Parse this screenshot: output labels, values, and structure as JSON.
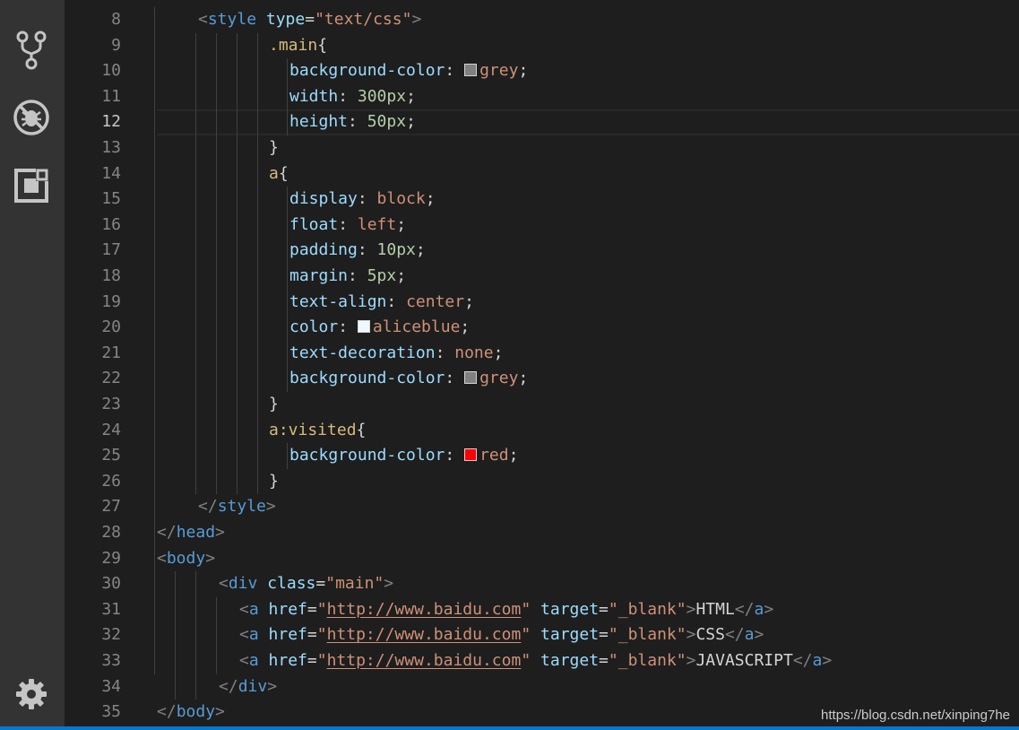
{
  "activity_bar": {
    "icons": [
      "source-control-icon",
      "debug-icon",
      "extensions-icon",
      "settings-gear-icon"
    ]
  },
  "editor": {
    "active_line": "12",
    "line_numbers": [
      "8",
      "9",
      "10",
      "11",
      "12",
      "13",
      "14",
      "15",
      "16",
      "17",
      "18",
      "19",
      "20",
      "21",
      "22",
      "23",
      "24",
      "25",
      "26",
      "27",
      "28",
      "29",
      "30",
      "31",
      "32",
      "33",
      "34",
      "35"
    ],
    "lines": [
      {
        "n": "8",
        "parts": [
          [
            "punc",
            "<"
          ],
          [
            "tag",
            "style"
          ],
          [
            "txt",
            " "
          ],
          [
            "attr",
            "type"
          ],
          [
            "txt",
            "="
          ],
          [
            "str",
            "\"text/css\""
          ],
          [
            "punc",
            ">"
          ]
        ]
      },
      {
        "n": "9",
        "parts": [
          [
            "sel",
            ".main"
          ],
          [
            "txt",
            "{"
          ]
        ]
      },
      {
        "n": "10",
        "parts": [
          [
            "prop",
            "background-color"
          ],
          [
            "txt",
            ": "
          ],
          [
            "swatch",
            "#808080"
          ],
          [
            "val",
            "grey"
          ],
          [
            "txt",
            ";"
          ]
        ]
      },
      {
        "n": "11",
        "parts": [
          [
            "prop",
            "width"
          ],
          [
            "txt",
            ": "
          ],
          [
            "num",
            "300px"
          ],
          [
            "txt",
            ";"
          ]
        ]
      },
      {
        "n": "12",
        "parts": [
          [
            "prop",
            "height"
          ],
          [
            "txt",
            ": "
          ],
          [
            "num",
            "50px"
          ],
          [
            "txt",
            ";"
          ]
        ]
      },
      {
        "n": "13",
        "parts": [
          [
            "txt",
            "}"
          ]
        ]
      },
      {
        "n": "14",
        "parts": [
          [
            "sel",
            "a"
          ],
          [
            "txt",
            "{"
          ]
        ]
      },
      {
        "n": "15",
        "parts": [
          [
            "prop",
            "display"
          ],
          [
            "txt",
            ": "
          ],
          [
            "val",
            "block"
          ],
          [
            "txt",
            ";"
          ]
        ]
      },
      {
        "n": "16",
        "parts": [
          [
            "prop",
            "float"
          ],
          [
            "txt",
            ": "
          ],
          [
            "val",
            "left"
          ],
          [
            "txt",
            ";"
          ]
        ]
      },
      {
        "n": "17",
        "parts": [
          [
            "prop",
            "padding"
          ],
          [
            "txt",
            ": "
          ],
          [
            "num",
            "10px"
          ],
          [
            "txt",
            ";"
          ]
        ]
      },
      {
        "n": "18",
        "parts": [
          [
            "prop",
            "margin"
          ],
          [
            "txt",
            ": "
          ],
          [
            "num",
            "5px"
          ],
          [
            "txt",
            ";"
          ]
        ]
      },
      {
        "n": "19",
        "parts": [
          [
            "prop",
            "text-align"
          ],
          [
            "txt",
            ": "
          ],
          [
            "val",
            "center"
          ],
          [
            "txt",
            ";"
          ]
        ]
      },
      {
        "n": "20",
        "parts": [
          [
            "prop",
            "color"
          ],
          [
            "txt",
            ": "
          ],
          [
            "swatch",
            "#f0f8ff"
          ],
          [
            "val",
            "aliceblue"
          ],
          [
            "txt",
            ";"
          ]
        ]
      },
      {
        "n": "21",
        "parts": [
          [
            "prop",
            "text-decoration"
          ],
          [
            "txt",
            ": "
          ],
          [
            "val",
            "none"
          ],
          [
            "txt",
            ";"
          ]
        ]
      },
      {
        "n": "22",
        "parts": [
          [
            "prop",
            "background-color"
          ],
          [
            "txt",
            ": "
          ],
          [
            "swatch",
            "#808080"
          ],
          [
            "val",
            "grey"
          ],
          [
            "txt",
            ";"
          ]
        ]
      },
      {
        "n": "23",
        "parts": [
          [
            "txt",
            "}"
          ]
        ]
      },
      {
        "n": "24",
        "parts": [
          [
            "sel",
            "a:visited"
          ],
          [
            "txt",
            "{"
          ]
        ]
      },
      {
        "n": "25",
        "parts": [
          [
            "prop",
            "background-color"
          ],
          [
            "txt",
            ": "
          ],
          [
            "swatch",
            "#ff0000"
          ],
          [
            "val",
            "red"
          ],
          [
            "txt",
            ";"
          ]
        ]
      },
      {
        "n": "26",
        "parts": [
          [
            "txt",
            "}"
          ]
        ]
      },
      {
        "n": "27",
        "parts": [
          [
            "punc",
            "</"
          ],
          [
            "tag",
            "style"
          ],
          [
            "punc",
            ">"
          ]
        ]
      },
      {
        "n": "28",
        "parts": [
          [
            "punc",
            "</"
          ],
          [
            "tag",
            "head"
          ],
          [
            "punc",
            ">"
          ]
        ]
      },
      {
        "n": "29",
        "parts": [
          [
            "punc",
            "<"
          ],
          [
            "tag",
            "body"
          ],
          [
            "punc",
            ">"
          ]
        ]
      },
      {
        "n": "30",
        "parts": [
          [
            "punc",
            "<"
          ],
          [
            "tag",
            "div"
          ],
          [
            "txt",
            " "
          ],
          [
            "attr",
            "class"
          ],
          [
            "txt",
            "="
          ],
          [
            "str",
            "\"main\""
          ],
          [
            "punc",
            ">"
          ]
        ]
      },
      {
        "n": "31",
        "parts": [
          [
            "punc",
            "<"
          ],
          [
            "tag",
            "a"
          ],
          [
            "txt",
            " "
          ],
          [
            "attr",
            "href"
          ],
          [
            "txt",
            "="
          ],
          [
            "str",
            "\""
          ],
          [
            "url",
            "http://www.baidu.com"
          ],
          [
            "str",
            "\""
          ],
          [
            "txt",
            " "
          ],
          [
            "attr",
            "target"
          ],
          [
            "txt",
            "="
          ],
          [
            "str",
            "\"_blank\""
          ],
          [
            "punc",
            ">"
          ],
          [
            "txt",
            "HTML"
          ],
          [
            "punc",
            "</"
          ],
          [
            "tag",
            "a"
          ],
          [
            "punc",
            ">"
          ]
        ]
      },
      {
        "n": "32",
        "parts": [
          [
            "punc",
            "<"
          ],
          [
            "tag",
            "a"
          ],
          [
            "txt",
            " "
          ],
          [
            "attr",
            "href"
          ],
          [
            "txt",
            "="
          ],
          [
            "str",
            "\""
          ],
          [
            "url",
            "http://www.baidu.com"
          ],
          [
            "str",
            "\""
          ],
          [
            "txt",
            " "
          ],
          [
            "attr",
            "target"
          ],
          [
            "txt",
            "="
          ],
          [
            "str",
            "\"_blank\""
          ],
          [
            "punc",
            ">"
          ],
          [
            "txt",
            "CSS"
          ],
          [
            "punc",
            "</"
          ],
          [
            "tag",
            "a"
          ],
          [
            "punc",
            ">"
          ]
        ]
      },
      {
        "n": "33",
        "parts": [
          [
            "punc",
            "<"
          ],
          [
            "tag",
            "a"
          ],
          [
            "txt",
            " "
          ],
          [
            "attr",
            "href"
          ],
          [
            "txt",
            "="
          ],
          [
            "str",
            "\""
          ],
          [
            "url",
            "http://www.baidu.com"
          ],
          [
            "str",
            "\""
          ],
          [
            "txt",
            " "
          ],
          [
            "attr",
            "target"
          ],
          [
            "txt",
            "="
          ],
          [
            "str",
            "\"_blank\""
          ],
          [
            "punc",
            ">"
          ],
          [
            "txt",
            "JAVASCRIPT"
          ],
          [
            "punc",
            "</"
          ],
          [
            "tag",
            "a"
          ],
          [
            "punc",
            ">"
          ]
        ]
      },
      {
        "n": "34",
        "parts": [
          [
            "punc",
            "</"
          ],
          [
            "tag",
            "div"
          ],
          [
            "punc",
            ">"
          ]
        ]
      },
      {
        "n": "35",
        "parts": [
          [
            "punc",
            "</"
          ],
          [
            "tag",
            "body"
          ],
          [
            "punc",
            ">"
          ]
        ]
      }
    ]
  },
  "colors": {
    "background": "#1e1e1e",
    "activity_bar": "#333333",
    "status_bar": "#007acc"
  },
  "watermark": "https://blog.csdn.net/xinping7he"
}
